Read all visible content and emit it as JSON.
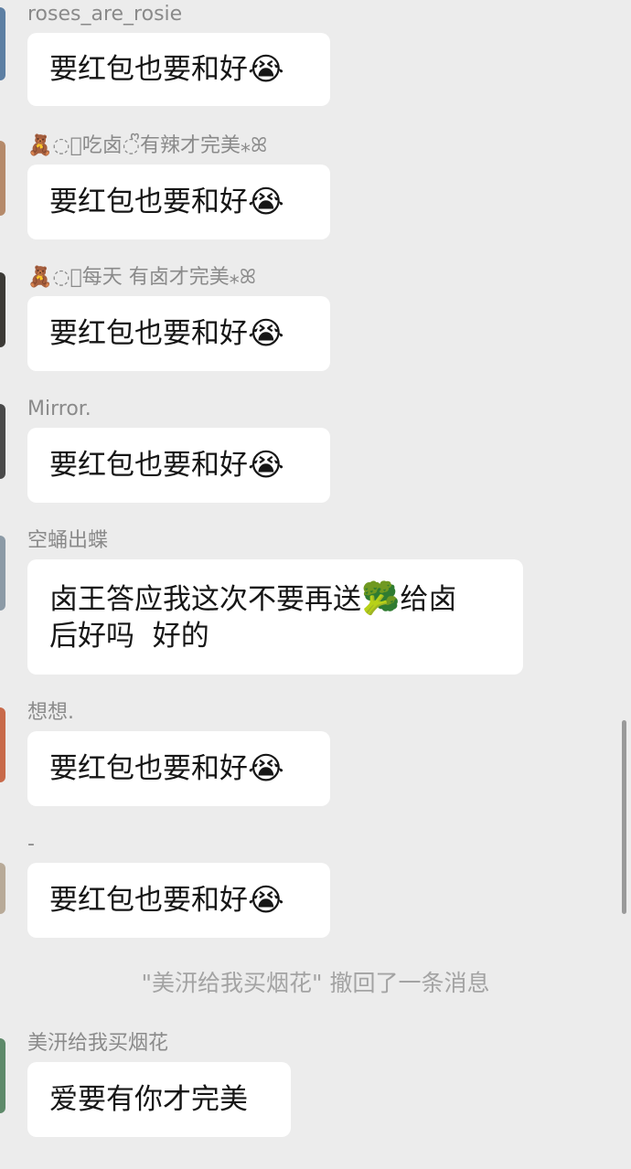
{
  "colors": {
    "background": "#ececec",
    "bubble": "#ffffff",
    "sender_text": "#8a8a8a",
    "system_text": "#a3a3a3"
  },
  "messages": [
    {
      "sender": "roses_are_rosie",
      "text": "要红包也要和好",
      "emoji": "😭"
    },
    {
      "sender": "🧸◌ᩚ吃卤◌ᩚ有辣才完美⁎ꕤ",
      "text": "要红包也要和好",
      "emoji": "😭"
    },
    {
      "sender": "🧸◌ᩚ每天 有卤才完美⁎ꕤ",
      "text": "要红包也要和好",
      "emoji": "😭"
    },
    {
      "sender": "Mirror.",
      "text": "要红包也要和好",
      "emoji": "😭"
    },
    {
      "sender": "空蛹出蝶",
      "text_line1": "卤王答应我这次不要再送",
      "emoji": "🥦",
      "text_line1_end": "给卤",
      "text_line2": "后好吗  好的"
    },
    {
      "sender": "想想.",
      "text": "要红包也要和好",
      "emoji": "😭"
    },
    {
      "sender": "-",
      "text": "要红包也要和好",
      "emoji": "😭"
    },
    {
      "sender": "美汧给我买烟花",
      "text": "爱要有你才完美"
    }
  ],
  "system_notice": "\"美汧给我买烟花\" 撤回了一条消息",
  "icons": {
    "crying": "loudly-crying-face-icon",
    "broccoli": "broccoli-icon"
  }
}
